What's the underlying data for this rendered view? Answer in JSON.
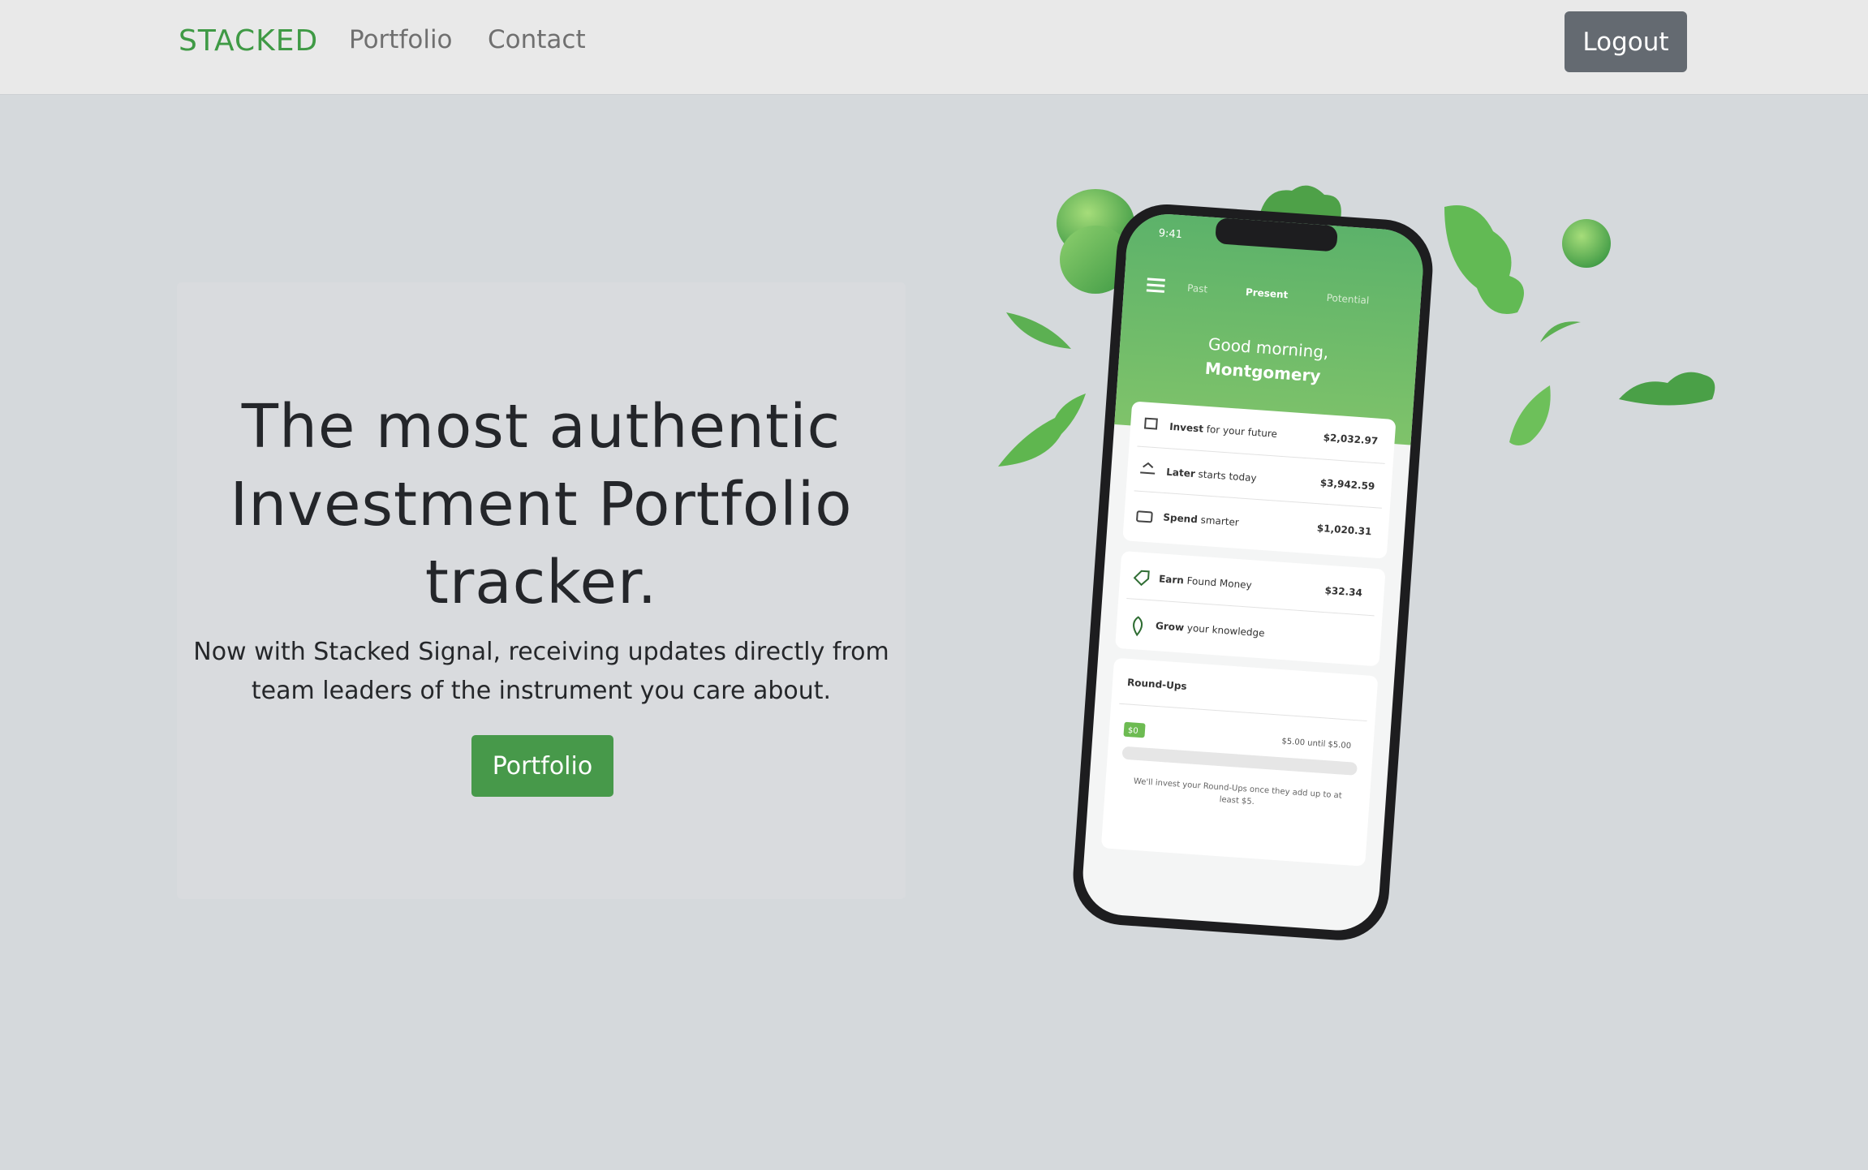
{
  "nav": {
    "brand": "STACKED",
    "links": [
      "Portfolio",
      "Contact"
    ],
    "logout_label": "Logout"
  },
  "hero": {
    "title_lines": [
      "The most authentic",
      "Investment Portfolio",
      "tracker."
    ],
    "subtitle_lines": [
      "Now with Stacked Signal, receiving updates directly from",
      "team leaders of the instrument you care about."
    ],
    "cta_label": "Portfolio"
  },
  "phone": {
    "time": "9:41",
    "tabs": [
      "Past",
      "Present",
      "Potential"
    ],
    "greeting": "Good morning,",
    "user_name": "Montgomery",
    "rows": [
      {
        "bold": "Invest",
        "rest": " for your future",
        "amount": "$2,032.97"
      },
      {
        "bold": "Later",
        "rest": " starts today",
        "amount": "$3,942.59"
      },
      {
        "bold": "Spend",
        "rest": " smarter",
        "amount": "$1,020.31"
      },
      {
        "bold": "Earn",
        "rest": " Found Money",
        "amount": "$32.34"
      },
      {
        "bold": "Grow",
        "rest": " your knowledge",
        "amount": ""
      }
    ],
    "roundups_title": "Round-Ups",
    "roundups_badge": "$0",
    "roundups_progress": "$5.00 until $5.00",
    "roundups_note_lines": [
      "We'll invest your Round-Ups once they add up to at",
      "least $5."
    ]
  },
  "colors": {
    "brand": "#3f9a45",
    "accent_green": "#47994a",
    "logout_bg": "#646a71",
    "page_bg": "#d5d9dc",
    "nav_bg": "#e9e9e9"
  }
}
